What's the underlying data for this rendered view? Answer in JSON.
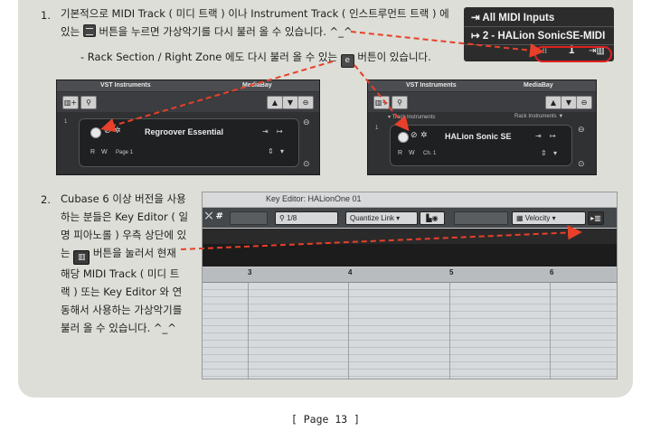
{
  "step1": {
    "number": "1.",
    "line1": "기본적으로 MIDI Track ( 미디 트랙 ) 이나 Instrument Track ( 인스트루먼트 트랙 ) 에",
    "line2a": "있는",
    "line2b": "버튼을 누르면 가상악기를 다시 불러 올 수 있습니다. ^_^",
    "sub_a": "- Rack Section / Right Zone 에도 다시 불러 올 수 있는",
    "sub_b": "버튼이 있습니다."
  },
  "midi_box": {
    "row1": "All MIDI Inputs",
    "row2": "2 - HALion SonicSE-MIDI",
    "channel": "1"
  },
  "vst_left": {
    "tab1": "VST Instruments",
    "tab2": "MediaBay",
    "slot_number": "1",
    "instrument": "Regroover Essential",
    "r_label": "R",
    "w_label": "W",
    "page": "Page 1"
  },
  "vst_right": {
    "tab1": "VST Instruments",
    "tab2": "MediaBay",
    "section_left": "Track Instruments",
    "section_right": "Rack Instruments",
    "slot_number": "1",
    "instrument": "HALion Sonic SE",
    "r_label": "R",
    "w_label": "W",
    "channel": "Ch. 1"
  },
  "step2": {
    "number": "2.",
    "lines": [
      "Cubase 6 이상 버전을 사용",
      "하는 분들은 Key Editor ( 일",
      "명 피아노롤 ) 우측 상단에 있",
      "는",
      "해당 MIDI Track ( 미디 트",
      "랙 ) 또는 Key Editor 와 연",
      "동해서 사용하는 가상악기를",
      "불러 올 수 있습니다. ^_^"
    ],
    "line4b": "버튼을 눌러서 현재"
  },
  "key_editor": {
    "title": "Key Editor: HALionOne 01",
    "quantize": "1/8",
    "quantize_link": "Quantize Link",
    "velocity": "Velocity",
    "bars": [
      "3",
      "4",
      "5",
      "6"
    ]
  },
  "footer": "[ Page 13 ]",
  "colors": {
    "arrow": "#e8402a",
    "panel": "#dcded7"
  }
}
